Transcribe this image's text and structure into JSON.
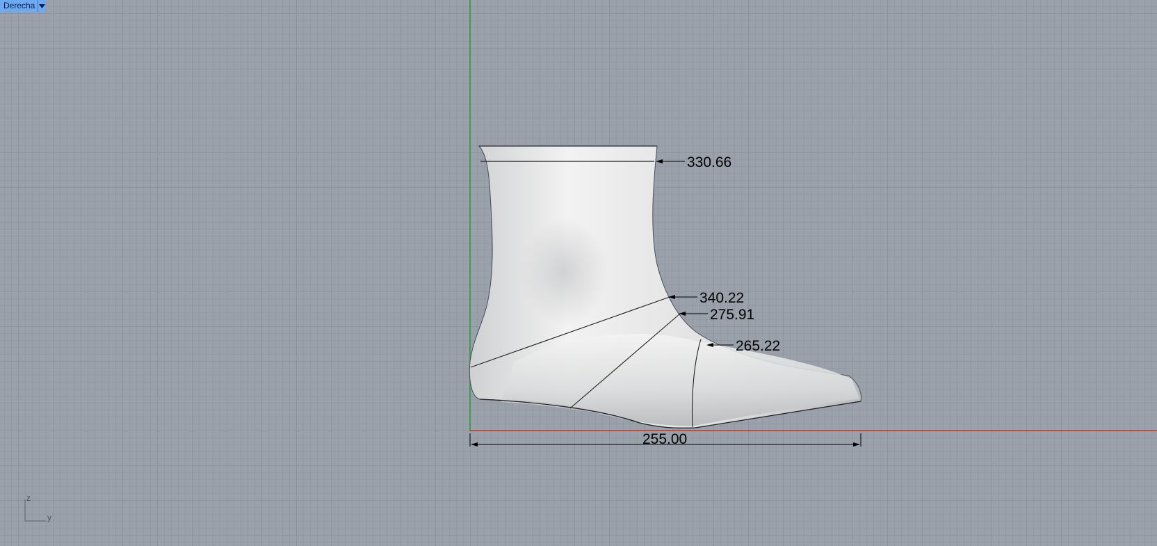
{
  "viewport": {
    "name": "Derecha",
    "background_color": "#9aa1ab",
    "accent_color": "#6ea9f3"
  },
  "dimensions": {
    "top_opening": "330.66",
    "ankle_diagonal": "340.22",
    "instep": "275.91",
    "ball": "265.22",
    "length": "255.00"
  },
  "axes": {
    "vertical_label": "z",
    "horizontal_label": "y",
    "green_axis_color": "#1f9c37",
    "red_axis_color": "#c0392b"
  },
  "icons": {
    "menu": "chevron-down-icon"
  }
}
